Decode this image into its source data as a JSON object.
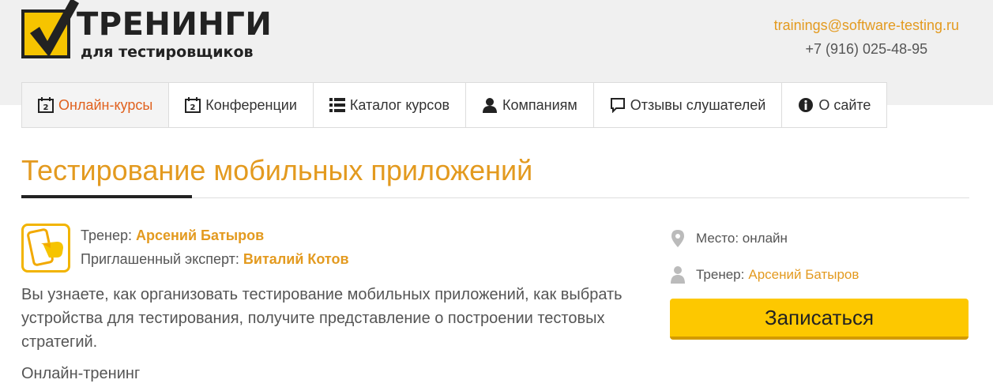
{
  "logo": {
    "title": "ТРЕНИНГИ",
    "subtitle": "для тестировщиков",
    "icon": "checkmark-logo-icon"
  },
  "contacts": {
    "email": "trainings@software-testing.ru",
    "phone": "+7 (916) 025-48-95"
  },
  "nav": {
    "items": [
      {
        "label": "Онлайн-курсы",
        "icon": "calendar-icon",
        "active": true
      },
      {
        "label": "Конференции",
        "icon": "calendar-icon",
        "active": false
      },
      {
        "label": "Каталог курсов",
        "icon": "list-icon",
        "active": false
      },
      {
        "label": "Компаниям",
        "icon": "user-icon",
        "active": false
      },
      {
        "label": "Отзывы слушателей",
        "icon": "comment-icon",
        "active": false
      },
      {
        "label": "О сайте",
        "icon": "info-icon",
        "active": false
      }
    ]
  },
  "course": {
    "title": "Тестирование мобильных приложений",
    "trainer_label": "Тренер:",
    "trainer_name": "Арсений Батыров",
    "expert_label": "Приглашенный эксперт:",
    "expert_name": "Виталий Котов",
    "description": "Вы узнаете, как организовать тестирование мобильных приложений, как выбрать устройства для тестирования, получите представление о построении тестовых стратегий.",
    "format": "Онлайн-тренинг",
    "icon": "mobile-tap-icon"
  },
  "sidebar": {
    "place": "Место: онлайн",
    "trainer_label": "Тренер:",
    "trainer_name": "Арсений Батыров",
    "enroll_label": "Записаться"
  },
  "colors": {
    "accent": "#e39a1f",
    "active_nav": "#e0611e",
    "button": "#fdc800",
    "logo_yellow": "#f6c400"
  }
}
